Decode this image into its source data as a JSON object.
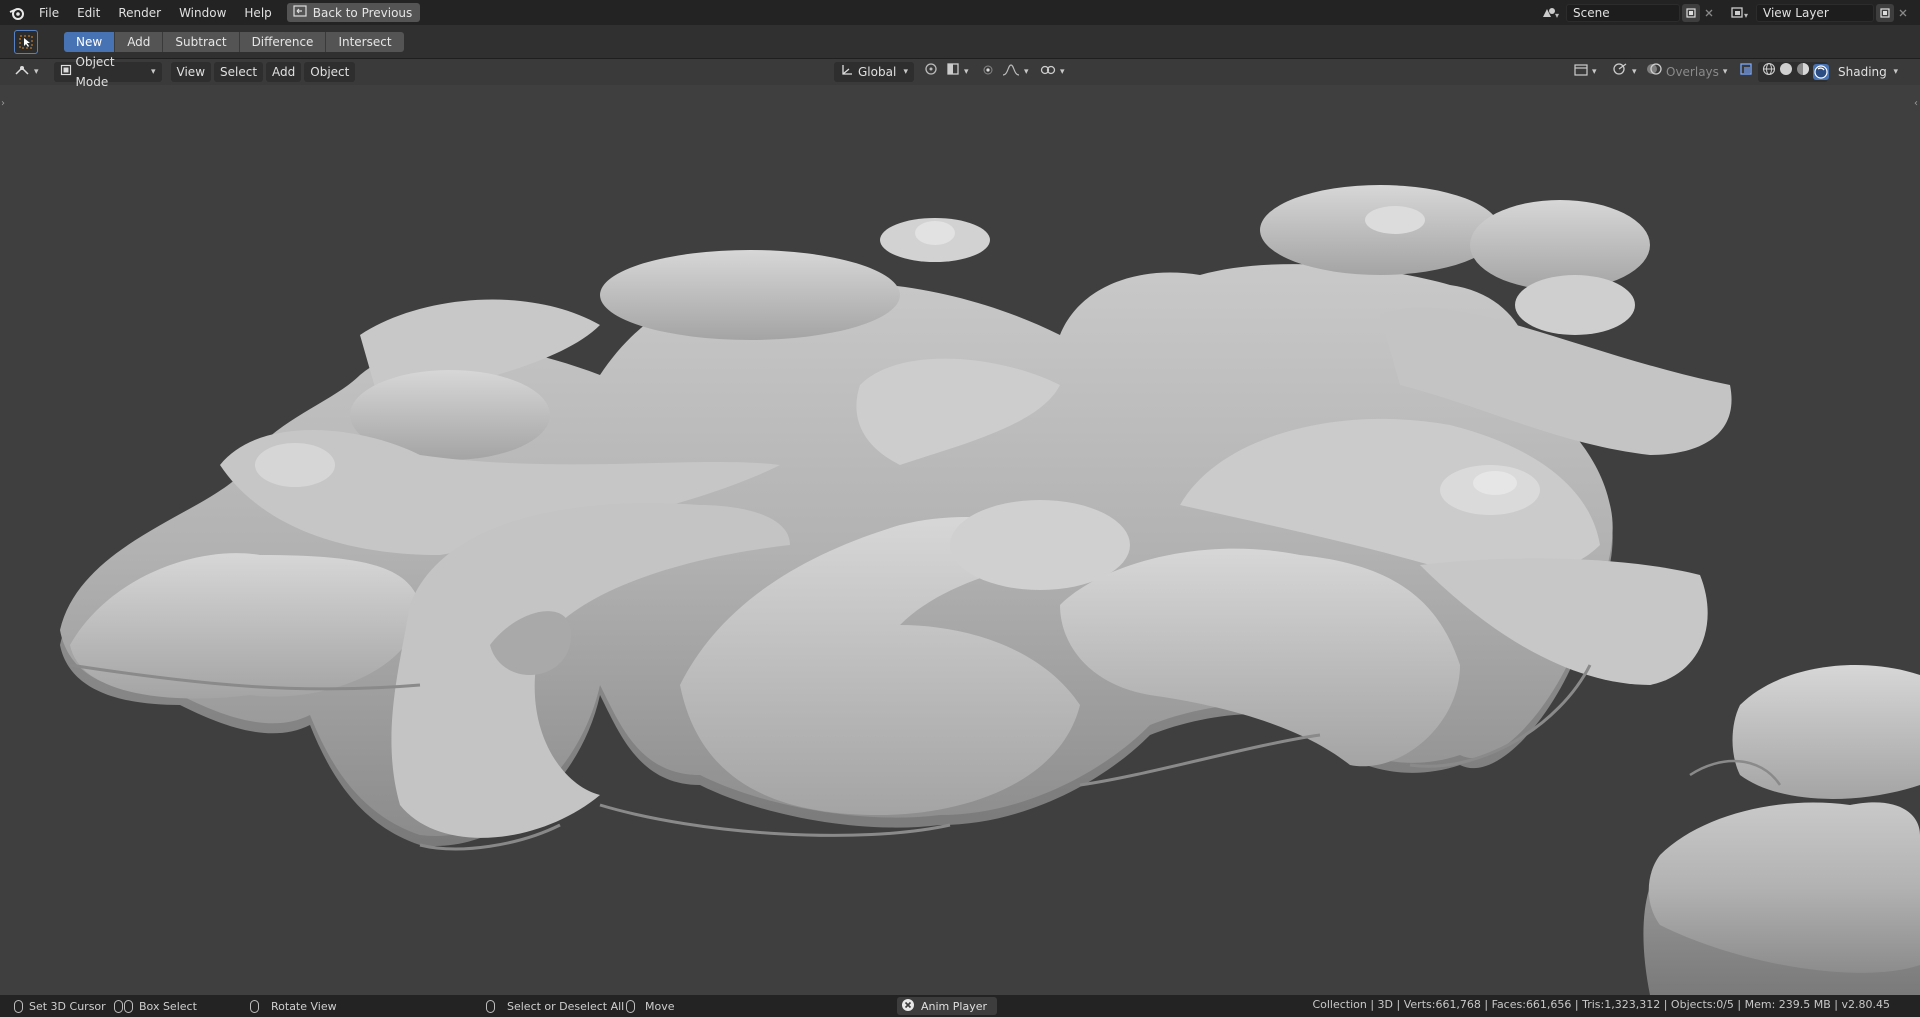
{
  "topbar": {
    "menu": [
      "File",
      "Edit",
      "Render",
      "Window",
      "Help"
    ],
    "back_label": "Back to Previous",
    "scene_value": "Scene",
    "view_layer_value": "View Layer"
  },
  "tool_header": {
    "modes": [
      "New",
      "Add",
      "Subtract",
      "Difference",
      "Intersect"
    ]
  },
  "viewport_header": {
    "mode": "Object Mode",
    "menus": [
      "View",
      "Select",
      "Add",
      "Object"
    ],
    "orientation": "Global",
    "overlays": "Overlays",
    "shading": "Shading"
  },
  "statusbar": {
    "set_cursor": "Set 3D Cursor",
    "box_select": "Box Select",
    "rotate_view": "Rotate View",
    "select_all": "Select or Deselect All",
    "move": "Move",
    "anim_player": "Anim Player",
    "stats": "Collection | 3D | Verts:661,768 | Faces:661,656 | Tris:1,323,312 | Objects:0/5 | Mem: 239.5 MB | v2.80.45"
  },
  "colors": {
    "accent": "#4772b3",
    "header": "#232323",
    "viewport": "#3f3f3f"
  }
}
